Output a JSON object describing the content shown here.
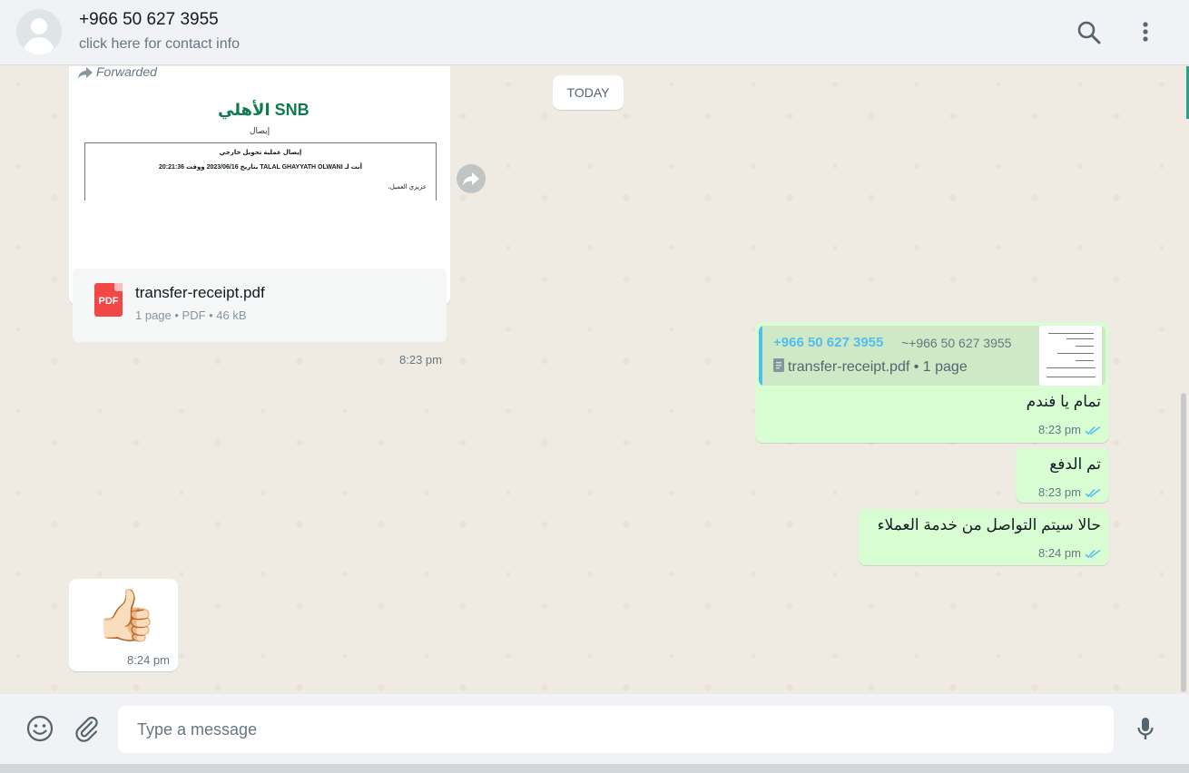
{
  "header": {
    "contact_name": "+966 50 627 3955",
    "contact_subtitle": "click here for contact info"
  },
  "date_divider": "TODAY",
  "messages": {
    "m1": {
      "forwarded_label": "Forwarded",
      "preview_bank": "الأهلي SNB",
      "preview_subtitle": "إيصال",
      "preview_line1": "إيصال عملية تحويل خارجي",
      "preview_line2": "أنت لـ TALAL GHAYYATH OLWANI بتاريخ 2023/06/16 ووقت 20:21:36",
      "preview_line3": "عزيزي العميل،",
      "file_badge": "PDF",
      "file_name": "transfer-receipt.pdf",
      "file_meta": "1 page • PDF • 46 kB",
      "time": "8:23 pm"
    },
    "m2": {
      "quote_name": "+966 50 627 3955",
      "quote_alt": "~+966 50 627 3955",
      "quote_file": "transfer-receipt.pdf • 1 page",
      "text": "تمام يا فندم",
      "time": "8:23 pm"
    },
    "m3": {
      "text": "تم الدفع",
      "time": "8:23 pm"
    },
    "m4": {
      "text": "حالا سيتم التواصل من خدمة العملاء",
      "time": "8:24 pm"
    },
    "m5": {
      "emoji": "👍🏻",
      "time": "8:24 pm"
    }
  },
  "composer": {
    "placeholder": "Type a message"
  },
  "icons": {
    "search": "search-icon",
    "menu": "kebab-menu-icon",
    "emoji": "emoji-icon",
    "attach": "paperclip-icon",
    "mic": "microphone-icon",
    "forward": "forward-icon",
    "ticks": "double-check-icon"
  },
  "colors": {
    "outgoing_bubble": "#d9fdd3",
    "incoming_bubble": "#ffffff",
    "chat_bg": "#efeae2",
    "read_ticks": "#53bdeb",
    "pdf_red": "#f24747"
  }
}
